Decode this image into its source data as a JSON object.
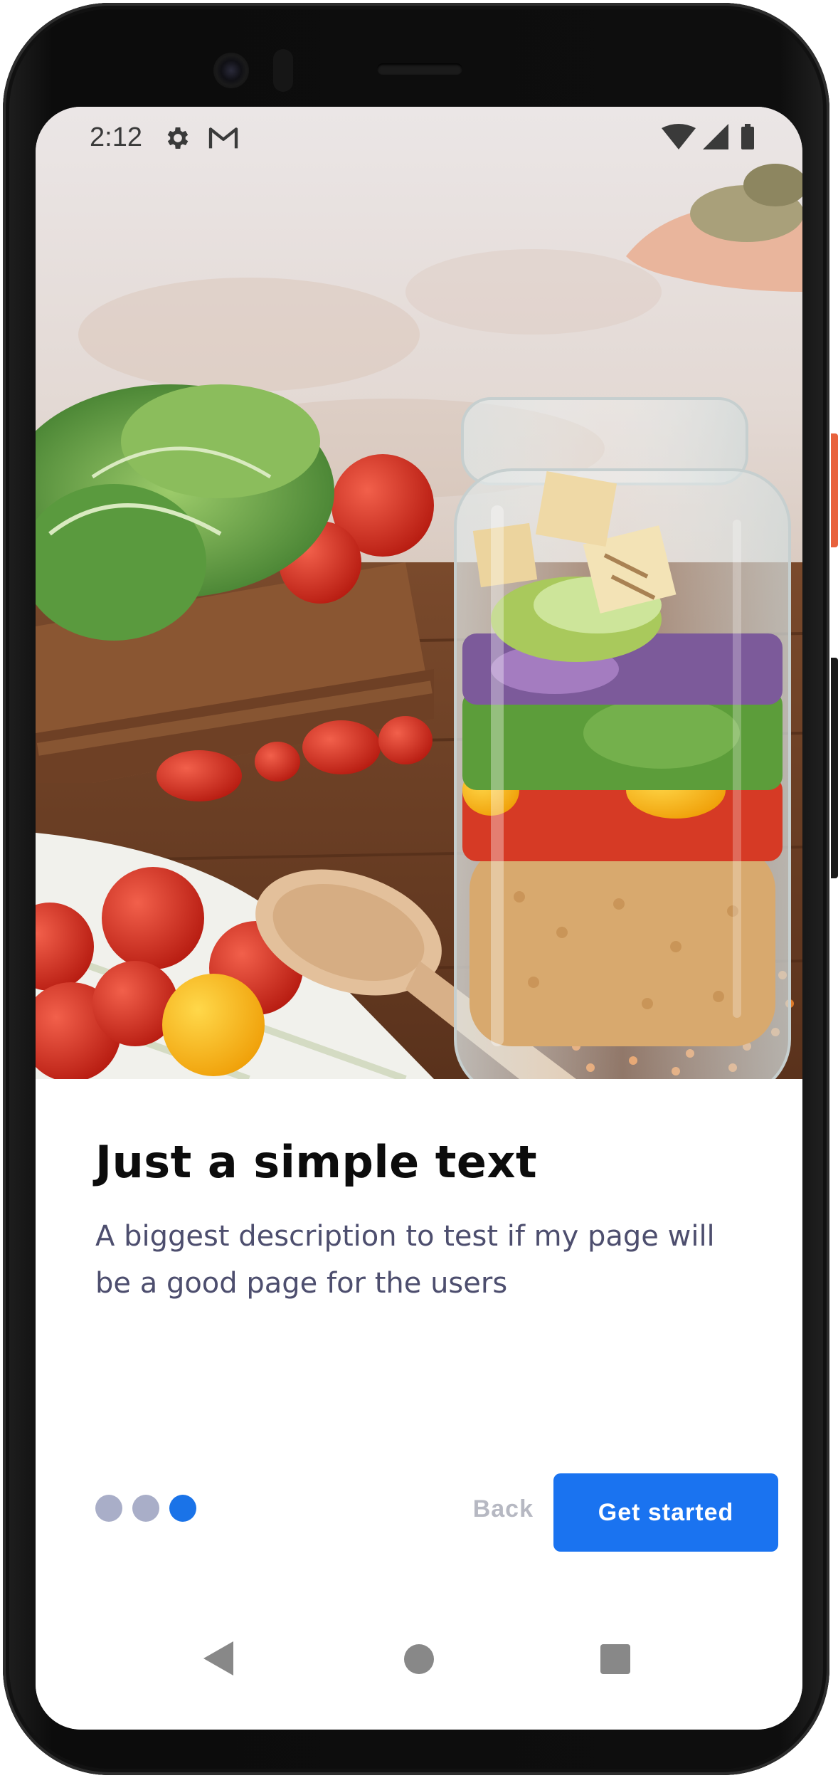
{
  "status_bar": {
    "time": "2:12",
    "left_icons": [
      "gear-icon",
      "gmail-icon"
    ],
    "right_icons": [
      "wifi-icon",
      "signal-icon",
      "battery-icon"
    ]
  },
  "hero_image": {
    "subject": "salad-jar-photo"
  },
  "onboarding": {
    "title": "Just a simple text",
    "description": "A biggest description to test if my page will be a good page for the users",
    "page_count": 3,
    "current_page": 3
  },
  "actions": {
    "back_label": "Back",
    "primary_label": "Get started"
  },
  "navigation_bar": {
    "buttons": [
      "back-icon",
      "home-icon",
      "recents-icon"
    ]
  },
  "colors": {
    "accent": "#1a73f0",
    "dot_inactive": "#a9aec8",
    "title_text": "#0c0c0c",
    "body_text": "#4d4e6e",
    "back_text": "#b6b8c2",
    "device_frame": "#0e0e0e",
    "side_button": "#e8623d"
  }
}
